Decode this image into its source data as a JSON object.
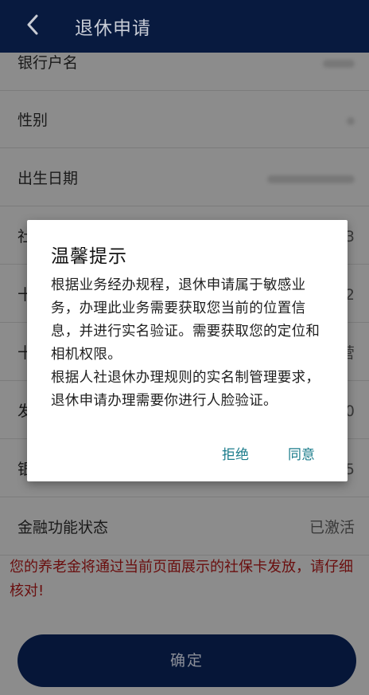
{
  "header": {
    "title": "退休申请"
  },
  "rows": [
    {
      "label": "银行户名",
      "value": ""
    },
    {
      "label": "性别",
      "value": ""
    },
    {
      "label": "出生日期",
      "value": ""
    },
    {
      "label": "社",
      "value": "3"
    },
    {
      "label": "十",
      "value": "2"
    },
    {
      "label": "十",
      "value": "营"
    },
    {
      "label": "发",
      "value": "0"
    },
    {
      "label": "银",
      "value": "5"
    },
    {
      "label": "金融功能状态",
      "value": "已激活"
    }
  ],
  "notice": "您的养老金将通过当前页面展示的社保卡发放，请仔细核对!",
  "confirm_label": "确定",
  "dialog": {
    "title": "温馨提示",
    "paragraph1": "根据业务经办规程，退休申请属于敏感业务，办理此业务需要获取您当前的位置信息，并进行实名验证。需要获取您的定位和相机权限。",
    "paragraph2": "根据人社退休办理规则的实名制管理要求，退休申请办理需要你进行人脸验证。",
    "refuse_label": "拒绝",
    "agree_label": "同意"
  }
}
